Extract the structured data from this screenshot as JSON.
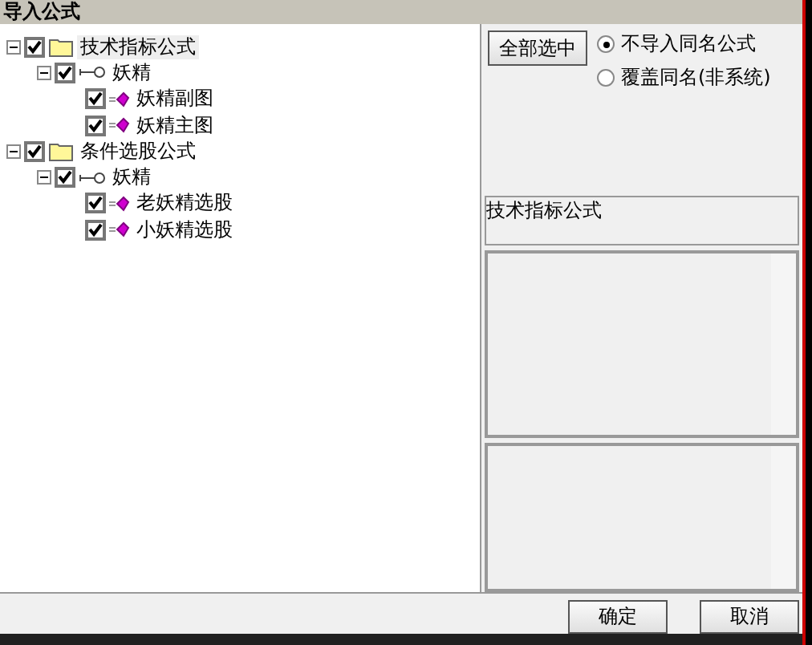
{
  "window": {
    "title": "导入公式"
  },
  "tree": [
    {
      "kind": "folder",
      "label": "技术指标公式",
      "checked": true,
      "expanded": true,
      "selected": true,
      "children": [
        {
          "kind": "group",
          "label": "妖精",
          "checked": true,
          "expanded": true,
          "selected": false,
          "children": [
            {
              "kind": "formula",
              "label": "妖精副图",
              "checked": true,
              "selected": false
            },
            {
              "kind": "formula",
              "label": "妖精主图",
              "checked": true,
              "selected": false
            }
          ]
        }
      ]
    },
    {
      "kind": "folder",
      "label": "条件选股公式",
      "checked": true,
      "expanded": true,
      "selected": false,
      "children": [
        {
          "kind": "group",
          "label": "妖精",
          "checked": true,
          "expanded": true,
          "selected": false,
          "children": [
            {
              "kind": "formula",
              "label": "老妖精选股",
              "checked": true,
              "selected": false
            },
            {
              "kind": "formula",
              "label": "小妖精选股",
              "checked": true,
              "selected": false
            }
          ]
        }
      ]
    }
  ],
  "select_all_button": "全部选中",
  "options": [
    {
      "label": "不导入同名公式",
      "selected": true
    },
    {
      "label": "覆盖同名(非系统)",
      "selected": false
    }
  ],
  "info_text": "技术指标公式",
  "buttons": [
    "确定",
    "取消"
  ]
}
